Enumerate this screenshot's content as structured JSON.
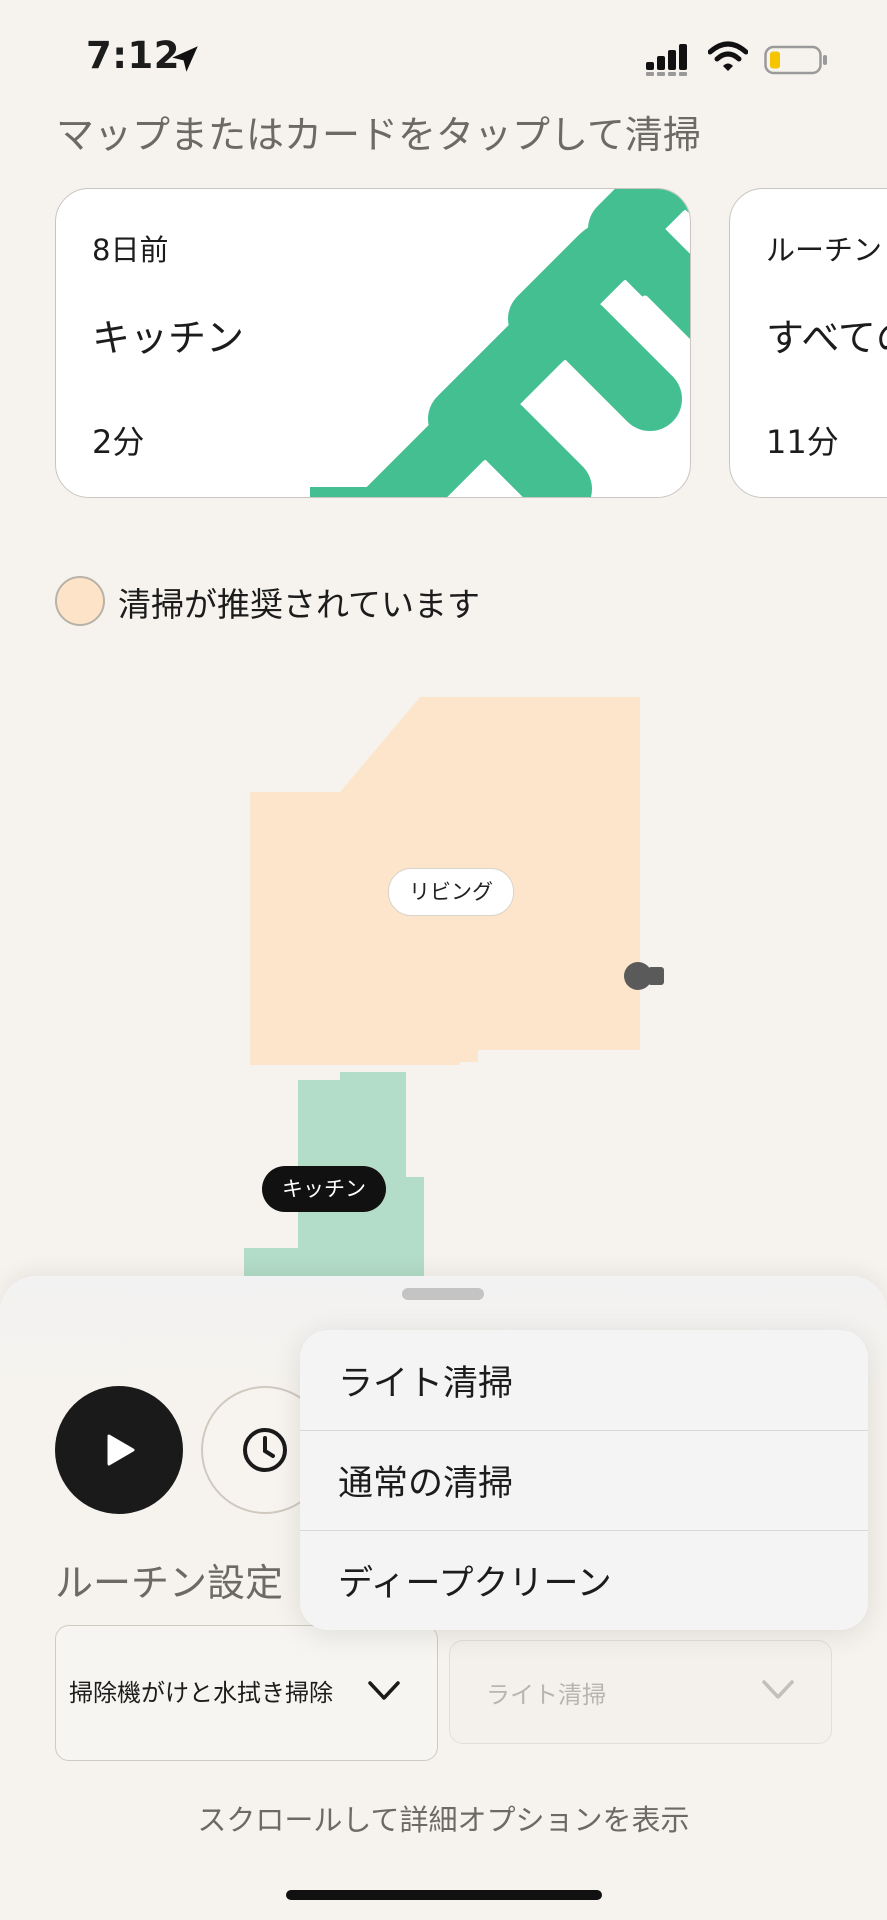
{
  "status_bar": {
    "time": "7:12"
  },
  "instruction": "マップまたはカードをタップして清掃",
  "cards": [
    {
      "when": "8日前",
      "name": "キッチン",
      "duration": "2分"
    },
    {
      "when": "ルーチン",
      "name": "すべての",
      "duration": "11分"
    }
  ],
  "legend": {
    "label": "清掃が推奨されています"
  },
  "map": {
    "rooms": [
      {
        "label": "リビング",
        "color": "#fde5cb"
      },
      {
        "label": "キッチン",
        "color": "#b3ddc8"
      }
    ]
  },
  "sheet": {
    "routine_title": "ルーチン設定",
    "mode_select": "掃除機がけと水拭き掃除",
    "intensity_select": "ライト清掃",
    "scroll_hint": "スクロールして詳細オプションを表示"
  },
  "menu": {
    "items": [
      "ライト清掃",
      "通常の清掃",
      "ディープクリーン"
    ]
  },
  "colors": {
    "accent_green": "#43bf92",
    "recommended": "#fde4c8"
  },
  "icons": [
    "location-arrow-icon",
    "signal-icon",
    "wifi-icon",
    "battery-icon",
    "play-icon",
    "clock-icon",
    "chevron-down-icon",
    "robot-icon"
  ]
}
